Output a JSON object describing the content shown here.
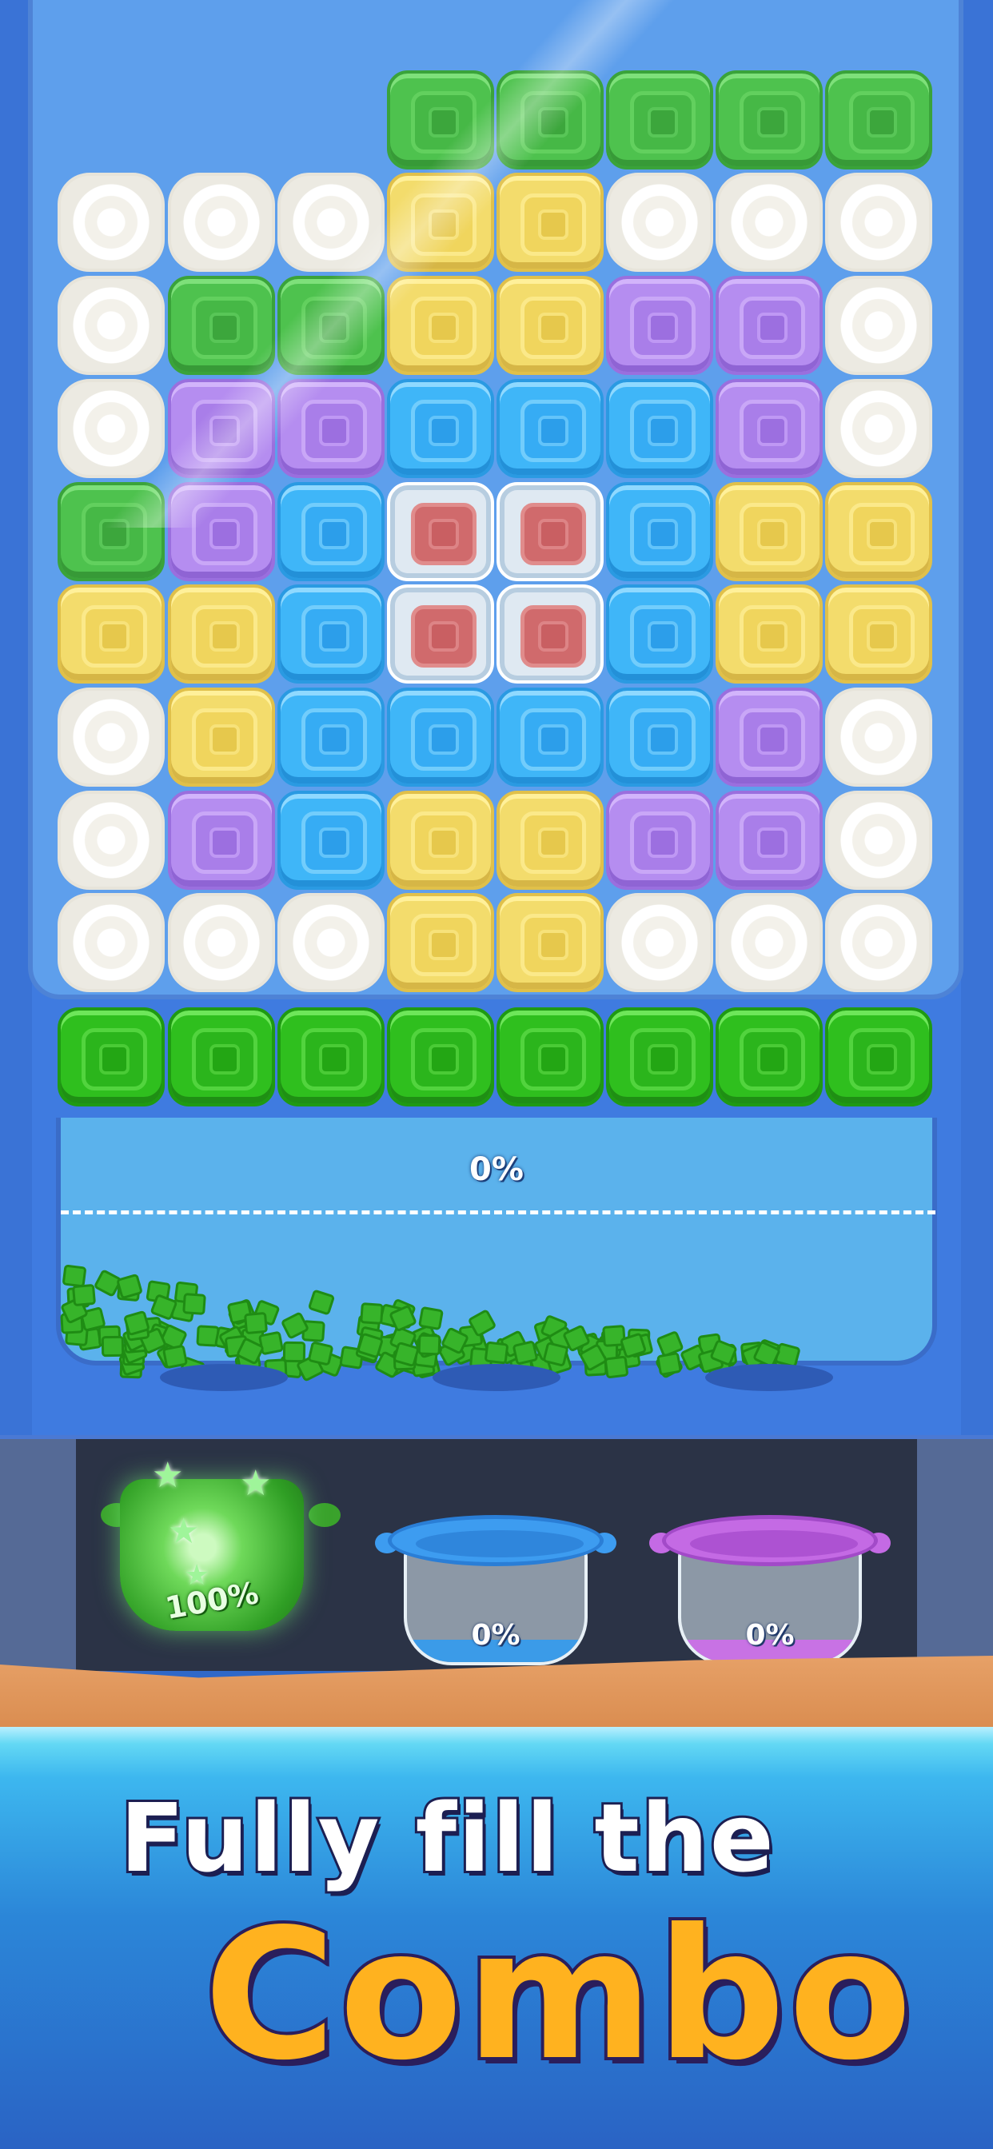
{
  "board": {
    "rows": [
      [
        "",
        "",
        "",
        "green",
        "green",
        "green",
        "green",
        "green"
      ],
      [
        "cream",
        "cream",
        "cream",
        "yellow",
        "yellow",
        "cream",
        "cream",
        "cream"
      ],
      [
        "cream",
        "green",
        "green",
        "yellow",
        "yellow",
        "purple",
        "purple",
        "cream"
      ],
      [
        "cream",
        "purple",
        "purple",
        "blue",
        "blue",
        "blue",
        "purple",
        "cream"
      ],
      [
        "green",
        "purple",
        "blue",
        "ice",
        "ice",
        "blue",
        "yellow",
        "yellow"
      ],
      [
        "yellow",
        "yellow",
        "blue",
        "ice",
        "ice",
        "blue",
        "yellow",
        "yellow"
      ],
      [
        "cream",
        "yellow",
        "blue",
        "blue",
        "blue",
        "blue",
        "purple",
        "cream"
      ],
      [
        "cream",
        "purple",
        "blue",
        "yellow",
        "yellow",
        "purple",
        "purple",
        "cream"
      ],
      [
        "cream",
        "cream",
        "cream",
        "yellow",
        "yellow",
        "cream",
        "cream",
        "cream"
      ]
    ],
    "conveyor_row": [
      "green",
      "green",
      "green",
      "green",
      "green",
      "green",
      "green",
      "green"
    ]
  },
  "tray": {
    "fill_percent_label": "0%"
  },
  "pots": [
    {
      "color": "green",
      "label": "100%",
      "state": "full"
    },
    {
      "color": "blue",
      "label": "0%",
      "state": "empty"
    },
    {
      "color": "purple",
      "label": "0%",
      "state": "empty"
    }
  ],
  "promo": {
    "line1": "Fully fill the",
    "line2": "Combo"
  },
  "colors": {
    "machine": "#3f7be0",
    "tray": "#5bb2ec",
    "combo_text": "#ffb21f"
  }
}
